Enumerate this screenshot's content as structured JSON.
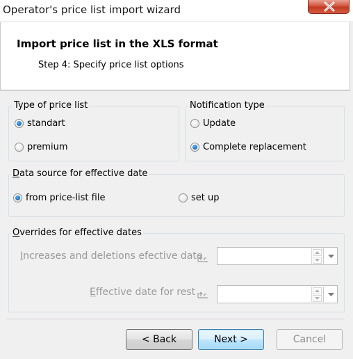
{
  "window": {
    "title": "Operator's price list import wizard"
  },
  "header": {
    "title": "Import price list in the XLS format",
    "step": "Step 4:  Specify price list options"
  },
  "type_group": {
    "label": "Type of price list",
    "options": [
      {
        "label": "standart",
        "checked": true
      },
      {
        "label": "premium",
        "checked": false
      }
    ]
  },
  "notification_group": {
    "label": "Notification type",
    "options": [
      {
        "label": "Update",
        "checked": false
      },
      {
        "label": "Complete replacement",
        "checked": true
      }
    ]
  },
  "source_group": {
    "label_prefix": "D",
    "label_rest": "ata source for effective date",
    "options": [
      {
        "label": "from price-list file",
        "checked": true
      },
      {
        "label": "set up",
        "checked": false
      }
    ]
  },
  "overrides_group": {
    "label_prefix": "O",
    "label_rest": "verrides for effective dates",
    "increases_prefix": "I",
    "increases_rest": "ncreases and deletions efective date",
    "increases_value": "",
    "rest_prefix": "E",
    "rest_rest": "ffective date for rest",
    "rest_value": ""
  },
  "buttons": {
    "back": "< Back",
    "next": "Next >",
    "cancel": "Cancel"
  },
  "colors": {
    "accent": "#3c7fb1",
    "close": "#c23a22",
    "disabled_text": "#9a9a9a"
  },
  "icons": {
    "close": "close-icon",
    "calendar": "calendar-icon",
    "spin_up": "spin-up-icon",
    "spin_down": "spin-down-icon",
    "dropdown": "chevron-down-icon"
  }
}
